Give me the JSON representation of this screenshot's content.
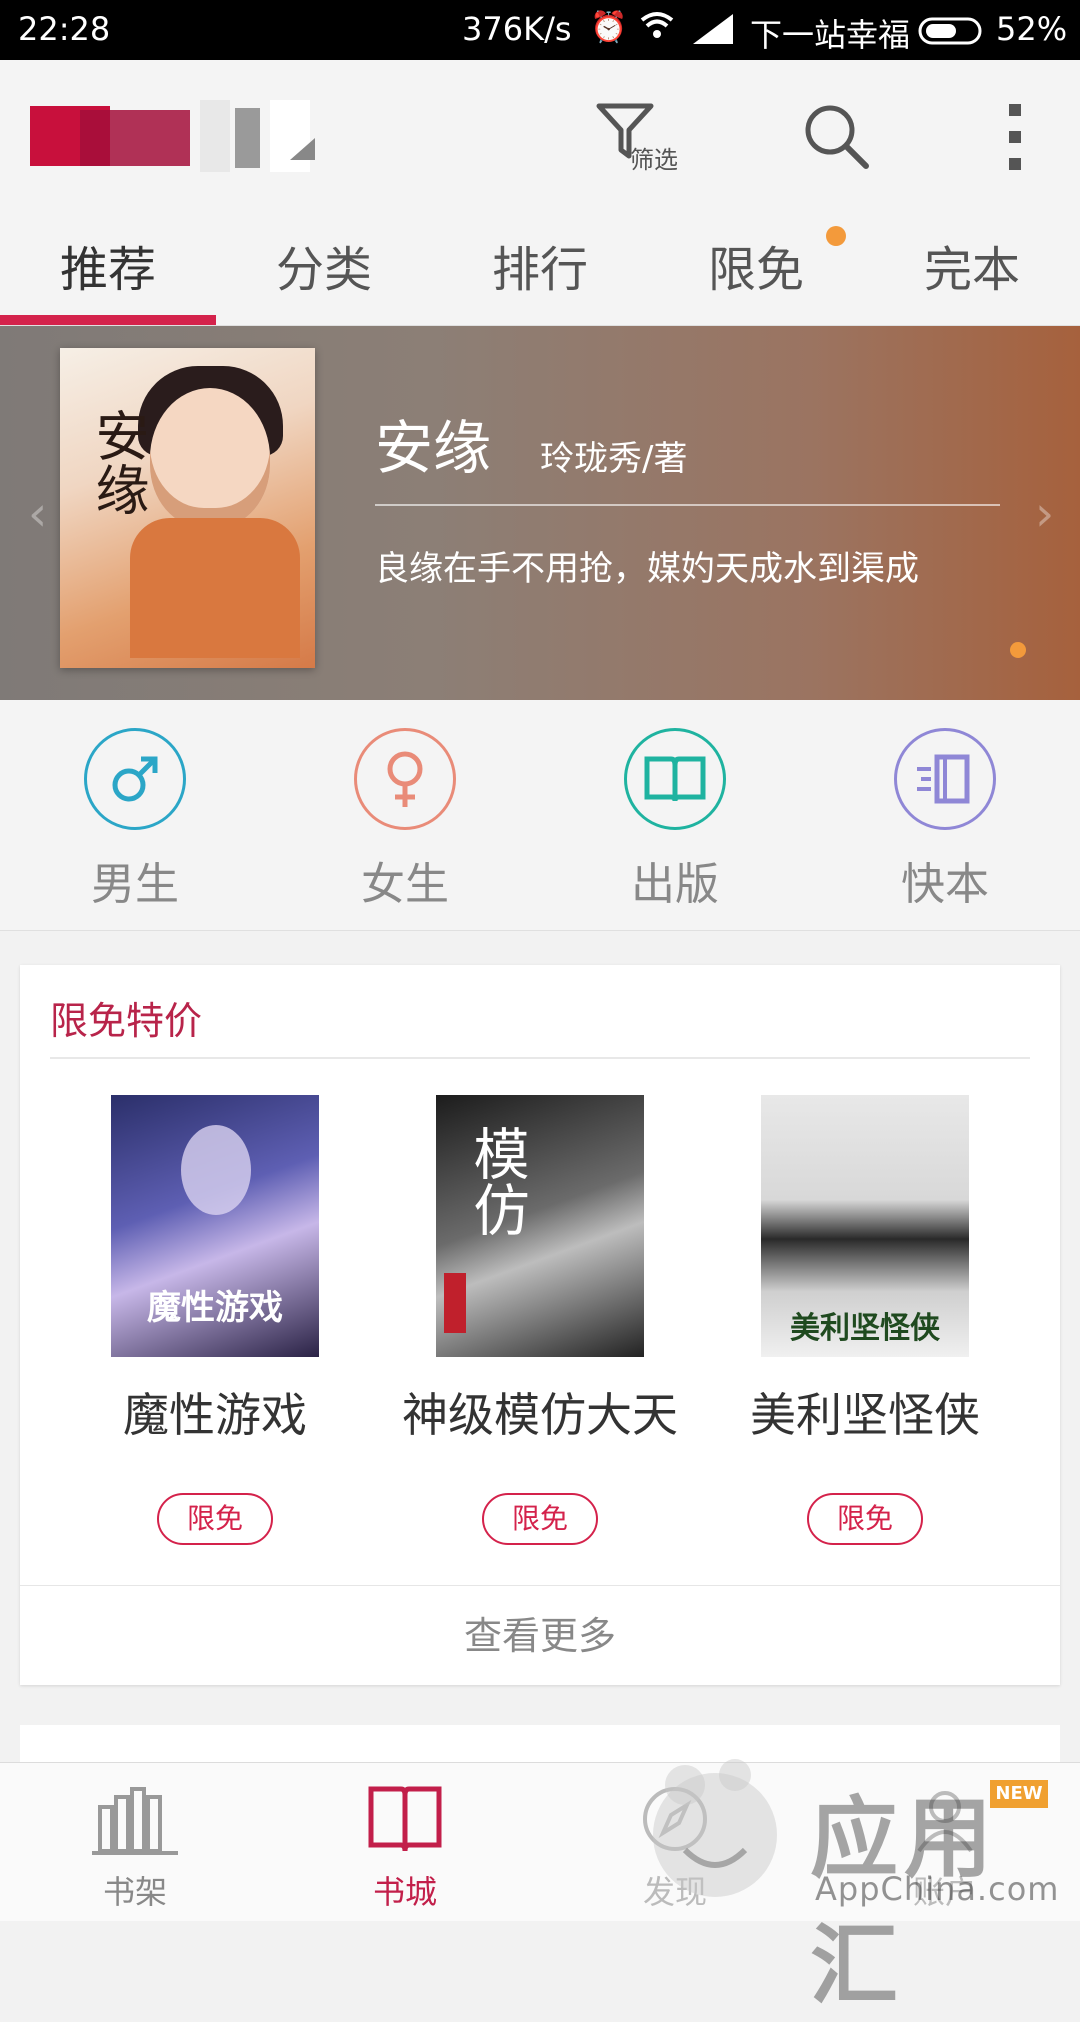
{
  "status_bar": {
    "time": "22:28",
    "speed": "376K/s",
    "carrier": "下一站幸福",
    "battery": "52%"
  },
  "header": {
    "filter_label": "筛选",
    "icons": [
      "filter-icon",
      "search-icon",
      "more-vert-icon"
    ]
  },
  "tabs": [
    {
      "label": "推荐",
      "active": true
    },
    {
      "label": "分类"
    },
    {
      "label": "排行"
    },
    {
      "label": "限免",
      "badge_dot": true
    },
    {
      "label": "完本"
    }
  ],
  "banner": {
    "title": "安缘",
    "author": "玲珑秀/著",
    "description": "良缘在手不用抢，媒妁天成水到渠成",
    "cover_text": "安缘"
  },
  "categories": [
    {
      "label": "男生",
      "icon": "male-icon",
      "color": "#2ba6c7"
    },
    {
      "label": "女生",
      "icon": "female-icon",
      "color": "#e98b78"
    },
    {
      "label": "出版",
      "icon": "book-open-icon",
      "color": "#1fb3a0"
    },
    {
      "label": "快本",
      "icon": "fast-book-icon",
      "color": "#8f87d6"
    }
  ],
  "free_section": {
    "title": "限免特价",
    "more_label": "查看更多",
    "books": [
      {
        "title": "魔性游戏",
        "tag": "限免",
        "cover_text": "魔性游戏"
      },
      {
        "title": "神级模仿大天",
        "tag": "限免",
        "cover_text": "模仿"
      },
      {
        "title": "美利坚怪侠",
        "tag": "限免",
        "cover_text": "美利坚怪侠"
      }
    ]
  },
  "bottom_nav": [
    {
      "label": "书架",
      "icon": "bookshelf-icon"
    },
    {
      "label": "书城",
      "icon": "bookstore-icon",
      "active": true
    },
    {
      "label": "发现",
      "icon": "compass-icon"
    },
    {
      "label": "账户",
      "icon": "account-icon"
    }
  ],
  "watermark": {
    "big": "应用汇",
    "small": "AppChina.com",
    "badge": "NEW"
  },
  "colors": {
    "accent": "#d4224b",
    "section_title": "#b8244a",
    "dot": "#f39a3b"
  }
}
